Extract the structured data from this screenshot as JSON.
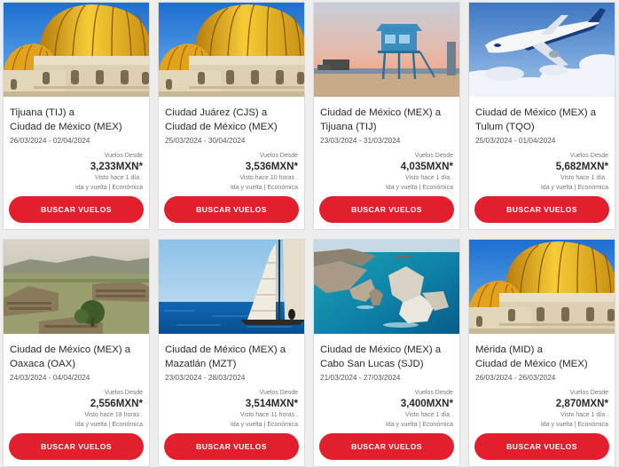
{
  "cards": [
    {
      "image": "palacio-bellas-artes",
      "route_line1": "Tijuana (TIJ) a",
      "route_line2": "Ciudad de México (MEX)",
      "dates": "26/03/2024 - 02/04/2024",
      "from_label": "Vuelos Desde",
      "price": "3,233MXN*",
      "seen": "Visto hace 1 día .",
      "type": "Ida y vuelta | Económica",
      "button": "BUSCAR VUELOS"
    },
    {
      "image": "palacio-bellas-artes",
      "route_line1": "Ciudad Juárez (CJS) a",
      "route_line2": "Ciudad de México (MEX)",
      "dates": "25/03/2024 - 30/04/2024",
      "from_label": "Vuelos Desde",
      "price": "3,536MXN*",
      "seen": "Visto hace 10 horas .",
      "type": "Ida y vuelta | Económica",
      "button": "BUSCAR VUELOS"
    },
    {
      "image": "tijuana-lifeguard-tower",
      "route_line1": "Ciudad de México (MEX) a",
      "route_line2": "Tijuana (TIJ)",
      "dates": "23/03/2024 - 31/03/2024",
      "from_label": "Vuelos Desde",
      "price": "4,035MXN*",
      "seen": "Visto hace 1 día .",
      "type": "Ida y vuelta | Económica",
      "button": "BUSCAR VUELOS"
    },
    {
      "image": "airplane-in-sky",
      "route_line1": "Ciudad de México (MEX) a",
      "route_line2": "Tulum (TQO)",
      "dates": "25/03/2024 - 01/04/2024",
      "from_label": "Vuelos Desde",
      "price": "5,682MXN*",
      "seen": "Visto hace 1 día .",
      "type": "Ida y vuelta | Económica",
      "button": "BUSCAR VUELOS"
    },
    {
      "image": "monte-alban-ruins",
      "route_line1": "Ciudad de México (MEX) a",
      "route_line2": "Oaxaca (OAX)",
      "dates": "24/03/2024 - 04/04/2024",
      "from_label": "Vuelos Desde",
      "price": "2,556MXN*",
      "seen": "Visto hace 18 horas .",
      "type": "Ida y vuelta | Económica",
      "button": "BUSCAR VUELOS"
    },
    {
      "image": "sailboat-ocean",
      "route_line1": "Ciudad de México (MEX) a",
      "route_line2": "Mazatlán (MZT)",
      "dates": "23/03/2024 - 28/03/2024",
      "from_label": "Vuelos Desde",
      "price": "3,514MXN*",
      "seen": "Visto hace 11 horas .",
      "type": "Ida y vuelta | Económica",
      "button": "BUSCAR VUELOS"
    },
    {
      "image": "los-cabos-arch",
      "route_line1": "Ciudad de México (MEX) a",
      "route_line2": "Cabo San Lucas (SJD)",
      "dates": "21/03/2024 - 27/03/2024",
      "from_label": "Vuelos Desde",
      "price": "3,400MXN*",
      "seen": "Visto hace 1 día .",
      "type": "Ida y vuelta | Económica",
      "button": "BUSCAR VUELOS"
    },
    {
      "image": "palacio-bellas-artes",
      "route_line1": "Mérida (MID) a",
      "route_line2": "Ciudad de México (MEX)",
      "dates": "26/03/2024 - 26/03/2024",
      "from_label": "Vuelos Desde",
      "price": "2,870MXN*",
      "seen": "Visto hace 1 día .",
      "type": "Ida y vuelta | Económica",
      "button": "BUSCAR VUELOS"
    }
  ],
  "colors": {
    "button": "#e41f2d",
    "text": "#2a2a2a",
    "muted": "#777777",
    "background": "#eeeeee"
  }
}
